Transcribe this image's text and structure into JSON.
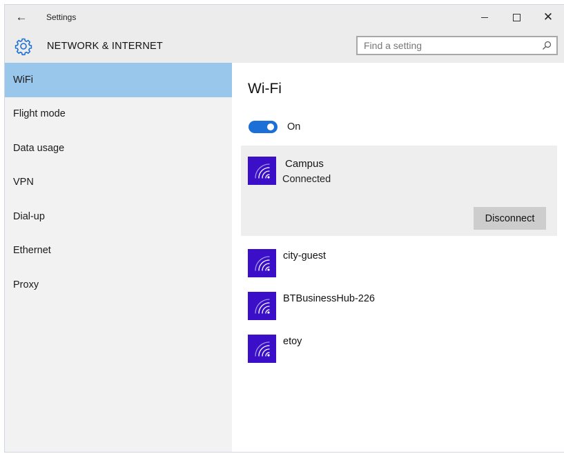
{
  "window": {
    "title": "Settings",
    "back_glyph": "←",
    "close_glyph": "✕"
  },
  "header": {
    "section_title": "NETWORK & INTERNET",
    "search_placeholder": "Find a setting"
  },
  "sidebar": {
    "items": [
      {
        "label": "WiFi",
        "active": true
      },
      {
        "label": "Flight mode"
      },
      {
        "label": "Data usage"
      },
      {
        "label": "VPN"
      },
      {
        "label": "Dial-up"
      },
      {
        "label": "Ethernet"
      },
      {
        "label": "Proxy"
      }
    ]
  },
  "main": {
    "title": "Wi-Fi",
    "toggle": {
      "state_label": "On",
      "on": true
    },
    "connected_network": {
      "name": "Campus",
      "status": "Connected",
      "action_label": "Disconnect"
    },
    "networks": [
      {
        "name": "city-guest"
      },
      {
        "name": "BTBusinessHub-226"
      },
      {
        "name": "etoy"
      }
    ]
  },
  "colors": {
    "accent": "#1c6fd6",
    "active_nav": "#99c6eb",
    "wifi_tile": "#3a0fc7",
    "chrome": "#ececec"
  },
  "icons": {
    "gear": "gear-icon",
    "search": "search-icon",
    "wifi": "wifi-icon"
  }
}
